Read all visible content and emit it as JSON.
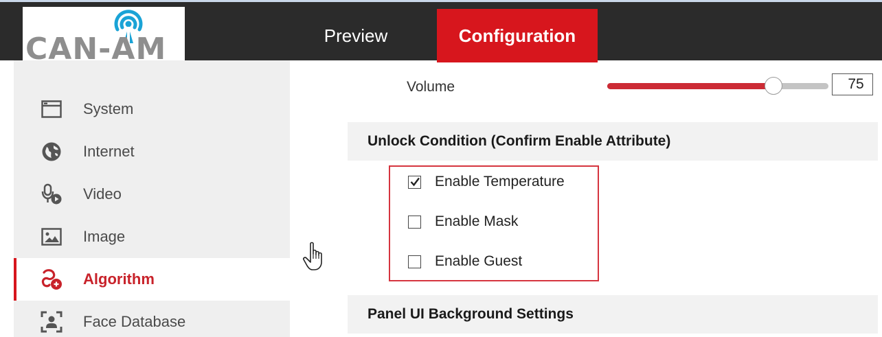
{
  "header": {
    "logo_text": "CAN-AM",
    "tabs": [
      {
        "label": "Preview",
        "active": false
      },
      {
        "label": "Configuration",
        "active": true
      }
    ]
  },
  "sidebar": {
    "items": [
      {
        "label": "System",
        "icon": "window-icon",
        "active": false
      },
      {
        "label": "Internet",
        "icon": "globe-icon",
        "active": false
      },
      {
        "label": "Video",
        "icon": "microphone-play-icon",
        "active": false
      },
      {
        "label": "Image",
        "icon": "image-icon",
        "active": false
      },
      {
        "label": "Algorithm",
        "icon": "algorithm-icon",
        "active": true
      },
      {
        "label": "Face Database",
        "icon": "face-frame-icon",
        "active": false
      }
    ]
  },
  "main": {
    "volume": {
      "label": "Volume",
      "value": "75",
      "level_percent": 75
    },
    "unlock_section": {
      "title": "Unlock Condition (Confirm Enable Attribute)",
      "options": [
        {
          "label": "Enable Temperature",
          "checked": true
        },
        {
          "label": "Enable Mask",
          "checked": false
        },
        {
          "label": "Enable Guest",
          "checked": false
        }
      ]
    },
    "panel_section": {
      "title": "Panel UI Background Settings"
    }
  },
  "colors": {
    "accent_red": "#d7161d",
    "topbar": "#2b2b2b",
    "sidebar_bg": "#efefef",
    "logo_gray": "#8e8e8e",
    "logo_blue": "#1aa3d6"
  }
}
